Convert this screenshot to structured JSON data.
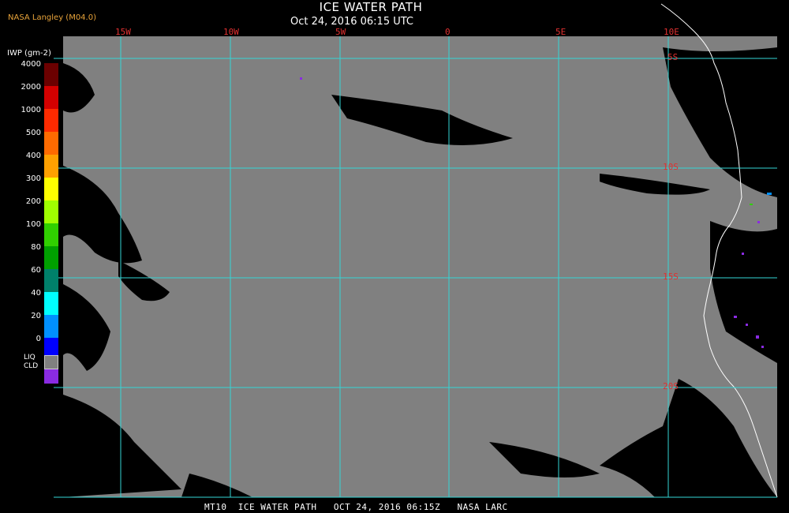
{
  "header": {
    "title": "ICE WATER PATH",
    "subtitle": "Oct 24, 2016 06:15 UTC",
    "source": "NASA Langley (M04.0)"
  },
  "map": {
    "longitude_labels": [
      "15W",
      "10W",
      "5W",
      "0",
      "5E",
      "10E"
    ],
    "latitude_labels": [
      "5S",
      "10S",
      "15S",
      "20S"
    ],
    "colors": {
      "background": "#000000",
      "liquid_cloud": "#808080",
      "grid": "#33d6d6",
      "coastline": "#ffffff",
      "labels": "#e03030"
    }
  },
  "legend": {
    "title": "IWP (gm-2)",
    "values": [
      "4000",
      "2000",
      "1000",
      "500",
      "400",
      "300",
      "200",
      "100",
      "80",
      "60",
      "40",
      "20",
      "0"
    ],
    "colors": [
      "#6b0000",
      "#d40000",
      "#ff2a00",
      "#ff6a00",
      "#ffa000",
      "#ffff00",
      "#a0ff00",
      "#30d000",
      "#00a000",
      "#00806a",
      "#00ffff",
      "#0090ff",
      "#0000ff",
      "#8a2be2"
    ],
    "liq_cld_label": "LIQ\nCLD"
  },
  "footer": {
    "text": "MT10  ICE WATER PATH   OCT 24, 2016 06:15Z   NASA LARC"
  }
}
